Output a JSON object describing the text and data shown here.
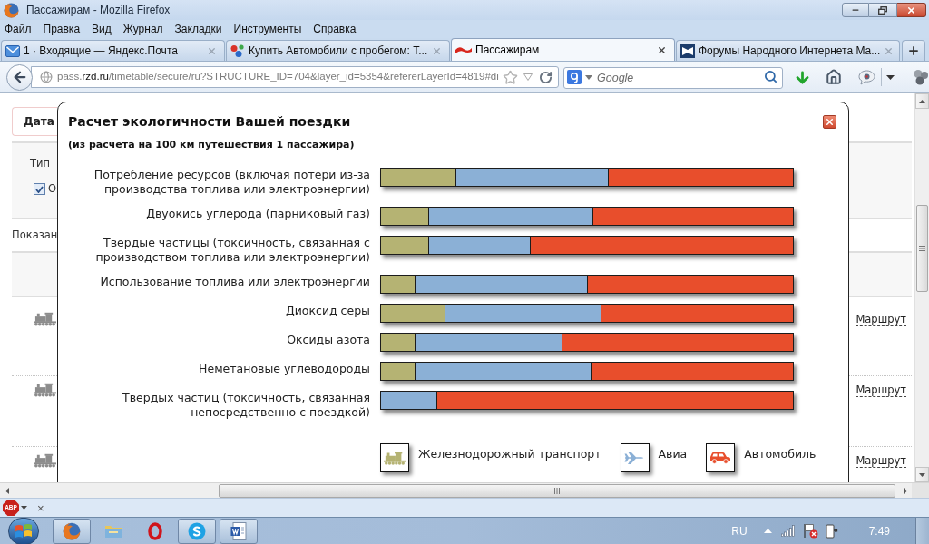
{
  "window": {
    "title": "Пассажирам - Mozilla Firefox"
  },
  "menu": [
    "Файл",
    "Правка",
    "Вид",
    "Журнал",
    "Закладки",
    "Инструменты",
    "Справка"
  ],
  "tabs": [
    {
      "label": "1 · Входящие — Яндекс.Почта",
      "kind": "mail",
      "selected": false
    },
    {
      "label": "Купить Автомобили с пробегом: Т...",
      "kind": "dots",
      "selected": false
    },
    {
      "label": "Пассажирам",
      "kind": "rzd",
      "selected": true
    },
    {
      "label": "Форумы Народного Интернета Ма...",
      "kind": "forum",
      "selected": false
    }
  ],
  "address": {
    "parts": [
      {
        "text": "pass.",
        "emphasis": false
      },
      {
        "text": "rzd.ru",
        "emphasis": true
      },
      {
        "text": "/timetable/secure/ru?STRUCTURE_ID=704&layer_id=5354&refererLayerId=4819#di",
        "emphasis": false
      }
    ]
  },
  "search": {
    "placeholder": "Google"
  },
  "page": {
    "date_tab": "Дата",
    "type_label": "Тип",
    "checkbox": {
      "label": "О",
      "checked": true
    },
    "shown_label": "Показан",
    "rows": [
      {
        "link": "Маршрут"
      },
      {
        "link": "Маршрут"
      },
      {
        "link": "Маршрут"
      }
    ]
  },
  "dialog": {
    "title": "Расчет экологичности Вашей поездки",
    "subtitle": "(из расчета на 100 км путешествия 1 пассажира)",
    "rows": [
      {
        "label": "Потребление ресурсов (включая потери из-за производства топлива или электроэнергии)"
      },
      {
        "label": "Двуокись углерода (парниковый газ)"
      },
      {
        "label": "Твердые частицы (токсичность, связанная с производством топлива или электроэнергии)"
      },
      {
        "label": "Использование топлива или электроэнергии"
      },
      {
        "label": "Диоксид серы"
      },
      {
        "label": "Оксиды азота"
      },
      {
        "label": "Неметановые углеводороды"
      },
      {
        "label": "Твердых частиц (токсичность, связанная непосредственно с поездкой)"
      }
    ],
    "legend": [
      {
        "label": "Железнодорожный транспорт",
        "kind": "rail"
      },
      {
        "label": "Авиа",
        "kind": "air"
      },
      {
        "label": "Автомобиль",
        "kind": "car"
      }
    ]
  },
  "addon_bar": {
    "badge": "ABP",
    "close": "×"
  },
  "taskbar": {
    "apps": [
      {
        "kind": "browser",
        "running": true
      },
      {
        "kind": "folder",
        "running": false
      },
      {
        "kind": "ring",
        "running": false
      },
      {
        "kind": "chat",
        "running": true
      },
      {
        "kind": "document",
        "running": true
      }
    ],
    "language": "RU",
    "time": "7:49"
  }
}
